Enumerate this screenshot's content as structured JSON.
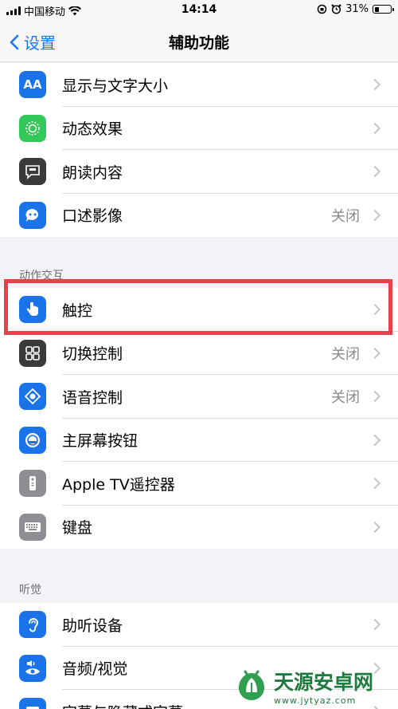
{
  "status_bar": {
    "carrier": "中国移动",
    "time": "14:14",
    "battery": "31%",
    "battery_level": 0.31
  },
  "nav": {
    "back_label": "设置",
    "title": "辅助功能"
  },
  "vision_group": {
    "items": [
      {
        "label": "显示与文字大小",
        "value": "",
        "icon": "text-size-icon",
        "icon_color": "#1a73e8"
      },
      {
        "label": "动态效果",
        "value": "",
        "icon": "motion-icon",
        "icon_color": "#34c759"
      },
      {
        "label": "朗读内容",
        "value": "",
        "icon": "speech-icon",
        "icon_color": "#3a3a3c"
      },
      {
        "label": "口述影像",
        "value": "关闭",
        "icon": "audio-description-icon",
        "icon_color": "#1a73e8"
      }
    ]
  },
  "interaction_group": {
    "header": "动作交互",
    "items": [
      {
        "label": "触控",
        "value": "",
        "icon": "hand-touch-icon",
        "icon_color": "#1a73e8"
      },
      {
        "label": "切换控制",
        "value": "关闭",
        "icon": "switch-control-icon",
        "icon_color": "#3a3a3c"
      },
      {
        "label": "语音控制",
        "value": "关闭",
        "icon": "voice-control-icon",
        "icon_color": "#1a73e8"
      },
      {
        "label": "主屏幕按钮",
        "value": "",
        "icon": "home-button-icon",
        "icon_color": "#1a73e8"
      },
      {
        "label": "Apple TV遥控器",
        "value": "",
        "icon": "tv-remote-icon",
        "icon_color": "#8e8e93"
      },
      {
        "label": "键盘",
        "value": "",
        "icon": "keyboard-icon",
        "icon_color": "#8e8e93"
      }
    ]
  },
  "hearing_group": {
    "header": "听觉",
    "items": [
      {
        "label": "助听设备",
        "value": "",
        "icon": "ear-icon",
        "icon_color": "#1a73e8"
      },
      {
        "label": "音频/视觉",
        "value": "",
        "icon": "speaker-eye-icon",
        "icon_color": "#1a73e8"
      },
      {
        "label": "字幕与隐藏式字幕",
        "value": "",
        "icon": "subtitles-icon",
        "icon_color": "#1a73e8"
      }
    ]
  },
  "watermark": {
    "title": "天源安卓网",
    "url": "www.jytyaz.com"
  }
}
